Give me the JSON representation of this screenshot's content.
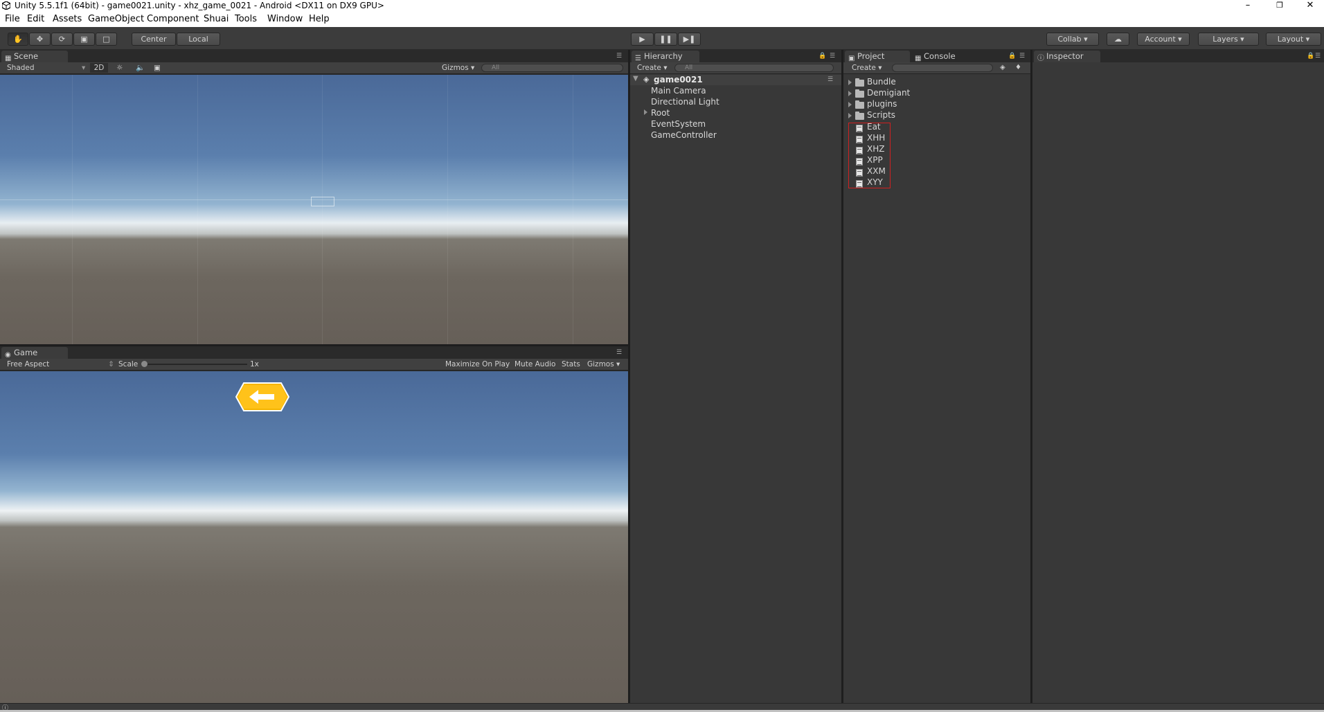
{
  "window": {
    "title": "Unity 5.5.1f1 (64bit) - game0021.unity - xhz_game_0021 - Android <DX11 on DX9 GPU>"
  },
  "menu": [
    "File",
    "Edit",
    "Assets",
    "GameObject",
    "Component",
    "Shuai",
    "Tools",
    "Window",
    "Help"
  ],
  "toolbar": {
    "center_label": "Center",
    "local_label": "Local",
    "collab_label": "Collab",
    "account_label": "Account",
    "layers_label": "Layers",
    "layout_label": "Layout"
  },
  "scene": {
    "tab_label": "Scene",
    "shading": "Shaded",
    "mode_2d": "2D",
    "gizmos": "Gizmos",
    "search_placeholder": "All"
  },
  "game": {
    "tab_label": "Game",
    "aspect": "Free Aspect",
    "scale_label": "Scale",
    "scale_value": "1x",
    "maximize": "Maximize On Play",
    "mute": "Mute Audio",
    "stats": "Stats",
    "gizmos": "Gizmos"
  },
  "hierarchy": {
    "tab_label": "Hierarchy",
    "create": "Create",
    "search_placeholder": "All",
    "scene_name": "game0021",
    "items": [
      "Main Camera",
      "Directional Light",
      "Root",
      "EventSystem",
      "GameController"
    ]
  },
  "project": {
    "tab_label": "Project",
    "console_label": "Console",
    "create": "Create",
    "folders": [
      "Bundle",
      "Demigiant",
      "plugins",
      "Scripts"
    ],
    "scripts": [
      "Eat",
      "XHH",
      "XHZ",
      "XPP",
      "XXM",
      "XYY"
    ]
  },
  "inspector": {
    "tab_label": "Inspector"
  },
  "colors": {
    "highlight_box": "#d02020",
    "button_yellow": "#f5b400"
  }
}
